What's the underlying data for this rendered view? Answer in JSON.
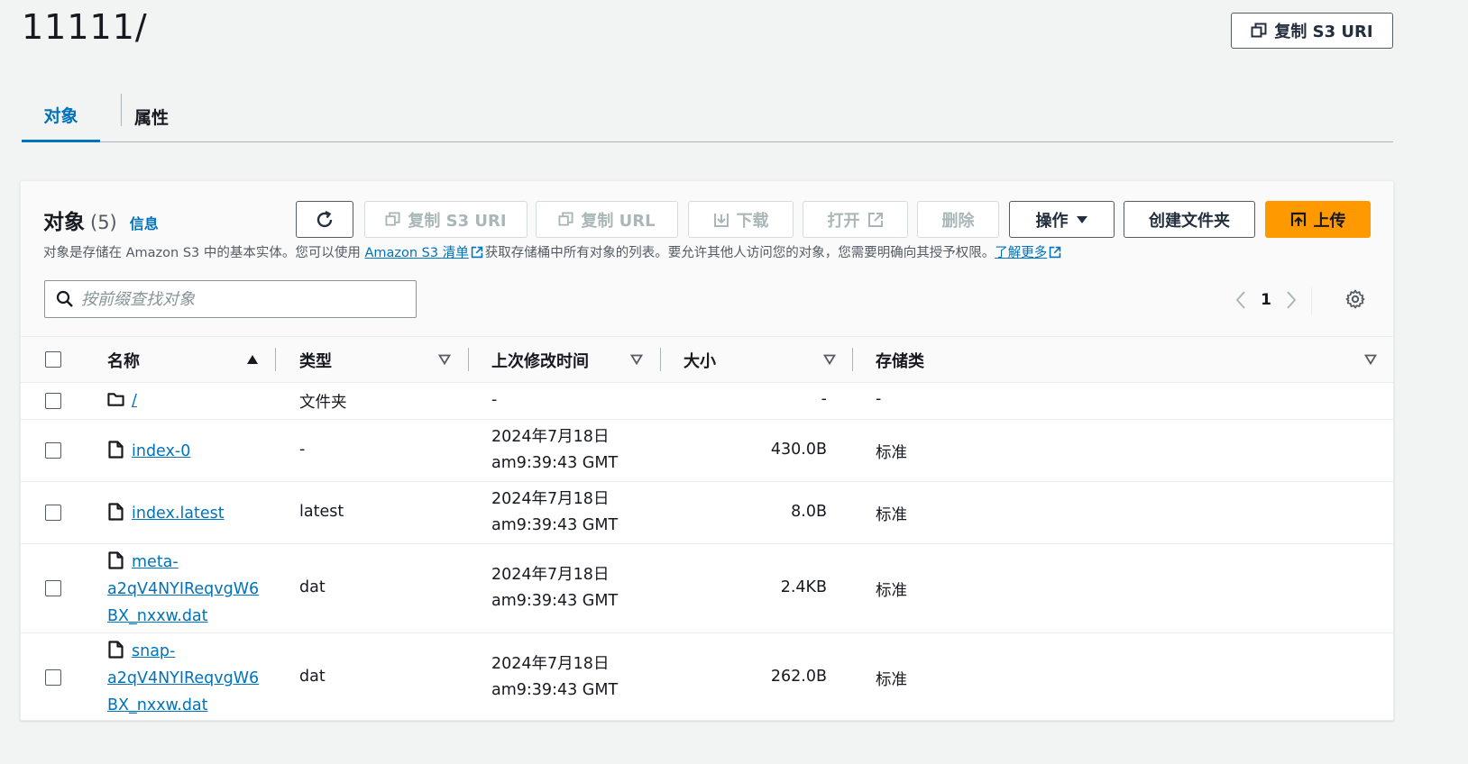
{
  "page": {
    "title": "11111/",
    "copy_s3_uri": "复制 S3 URI"
  },
  "tabs": [
    {
      "label": "对象",
      "active": true
    },
    {
      "label": "属性",
      "active": false
    }
  ],
  "panel": {
    "title": "对象",
    "count": "(5)",
    "info": "信息",
    "desc_part1": "对象是存储在 Amazon S3 中的基本实体。您可以使用 ",
    "desc_link1": "Amazon S3 清单",
    "desc_part2": "获取存储桶中所有对象的列表。要允许其他人访问您的对象，您需要明确向其授予权限。",
    "desc_link2": "了解更多"
  },
  "toolbar": {
    "refresh": "refresh-icon",
    "copy_s3_uri": "复制 S3 URI",
    "copy_url": "复制 URL",
    "download": "下载",
    "open": "打开",
    "delete": "删除",
    "actions": "操作",
    "create_folder": "创建文件夹",
    "upload": "上传"
  },
  "search": {
    "placeholder": "按前缀查找对象"
  },
  "pagination": {
    "current_page": "1"
  },
  "columns": {
    "name": "名称",
    "type": "类型",
    "modified": "上次修改时间",
    "size": "大小",
    "storage": "存储类"
  },
  "rows": [
    {
      "name": "/",
      "type": "文件夹",
      "modified_1": "-",
      "modified_2": "",
      "size": "-",
      "storage": "-",
      "icon": "folder-icon"
    },
    {
      "name": "index-0",
      "type": "-",
      "modified_1": "2024年7月18日",
      "modified_2": "am9:39:43 GMT",
      "size": "430.0B",
      "storage": "标准",
      "icon": "file-icon"
    },
    {
      "name": "index.latest",
      "type": "latest",
      "modified_1": "2024年7月18日",
      "modified_2": "am9:39:43 GMT",
      "size": "8.0B",
      "storage": "标准",
      "icon": "file-icon"
    },
    {
      "name_1": "meta-",
      "name_2": "a2qV4NYIReqvgW6",
      "name_3": "BX_nxxw.dat",
      "type": "dat",
      "modified_1": "2024年7月18日",
      "modified_2": "am9:39:43 GMT",
      "size": "2.4KB",
      "storage": "标准",
      "icon": "file-icon"
    },
    {
      "name_1": "snap-",
      "name_2": "a2qV4NYIReqvgW6",
      "name_3": "BX_nxxw.dat",
      "type": "dat",
      "modified_1": "2024年7月18日",
      "modified_2": "am9:39:43 GMT",
      "size": "262.0B",
      "storage": "标准",
      "icon": "file-icon"
    }
  ],
  "colors": {
    "link": "#0073bb",
    "primary": "#ff9900",
    "text": "#16191f",
    "disabled": "#aab7b8"
  }
}
